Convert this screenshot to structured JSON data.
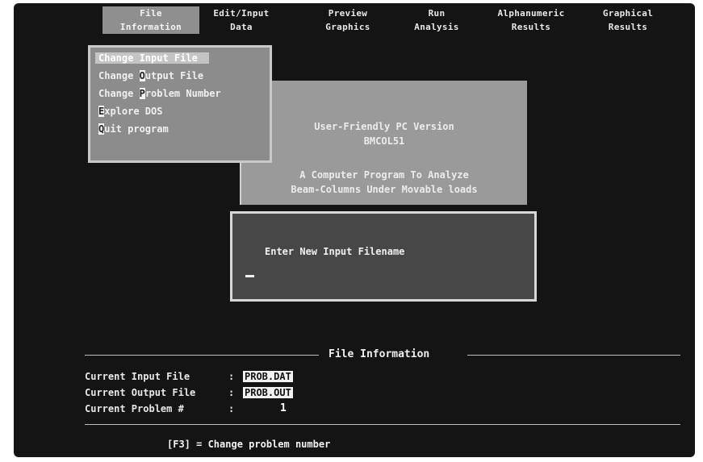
{
  "menu": [
    {
      "line1": "File",
      "line2": "Information",
      "active": true
    },
    {
      "line1": "Edit/Input",
      "line2": "Data"
    },
    {
      "line1": "Preview",
      "line2": "Graphics"
    },
    {
      "line1": "Run",
      "line2": "Analysis"
    },
    {
      "line1": "Alphanumeric",
      "line2": "Results"
    },
    {
      "line1": "Graphical",
      "line2": "Results"
    }
  ],
  "dropdown": {
    "items": [
      {
        "pre": "C",
        "rest": "hange Input File",
        "selected": true
      },
      {
        "pre": "Change ",
        "hot": "O",
        "rest": "utput File"
      },
      {
        "pre": "Change ",
        "hot": "P",
        "rest": "roblem Number"
      },
      {
        "pre": "",
        "hot": "E",
        "rest": "xplore DOS"
      },
      {
        "pre": "",
        "hot": "Q",
        "rest": "uit program"
      }
    ]
  },
  "about": {
    "line1": "User-Friendly PC Version",
    "line2": "BMCOL51",
    "line3": "A Computer Program To Analyze",
    "line4": "Beam-Columns Under Movable loads"
  },
  "dialog": {
    "prompt": "Enter New Input Filename",
    "input_value": ""
  },
  "file_info": {
    "title": "File Information",
    "input_label": "Current Input File",
    "input_value": "PROB.DAT",
    "output_label": "Current Output File",
    "output_value": "PROB.OUT",
    "problem_label": "Current Problem #",
    "problem_value": "1"
  },
  "hint": "[F3] = Change problem number"
}
